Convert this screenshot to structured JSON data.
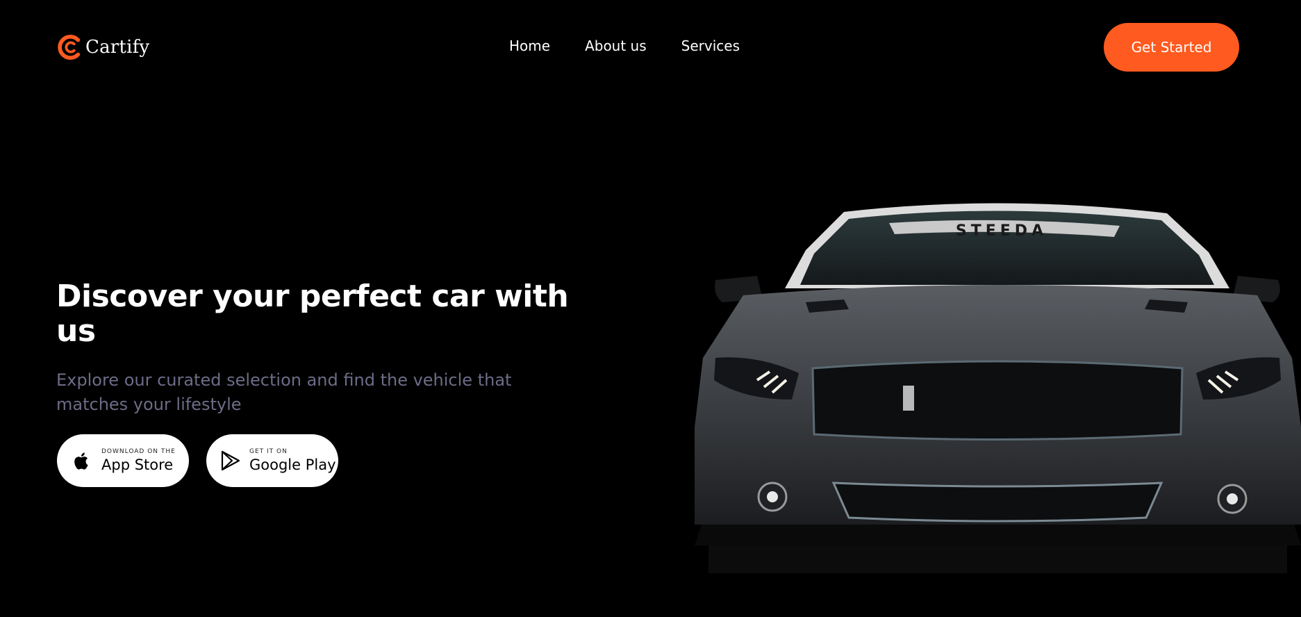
{
  "brand": {
    "name": "Cartify",
    "accent_color": "#ff5a1f",
    "logo_icon": "cartify-logo-icon"
  },
  "nav": {
    "items": [
      {
        "label": "Home"
      },
      {
        "label": "About us"
      },
      {
        "label": "Services"
      }
    ]
  },
  "header": {
    "cta_label": "Get Started"
  },
  "hero": {
    "title": "Discover your perfect car with us",
    "subtitle": "Explore our curated selection and find the vehicle that matches your lifestyle",
    "app_store": {
      "small": "DOWNLOAD ON THE",
      "big": "App Store",
      "icon": "apple-icon"
    },
    "google_play": {
      "small": "GET IT ON",
      "big": "Google Play",
      "icon": "play-icon"
    },
    "image": {
      "windshield_banner": "STEEDA"
    }
  },
  "colors": {
    "background": "#000000",
    "text": "#ffffff",
    "subtitle": "#6c6c87"
  }
}
